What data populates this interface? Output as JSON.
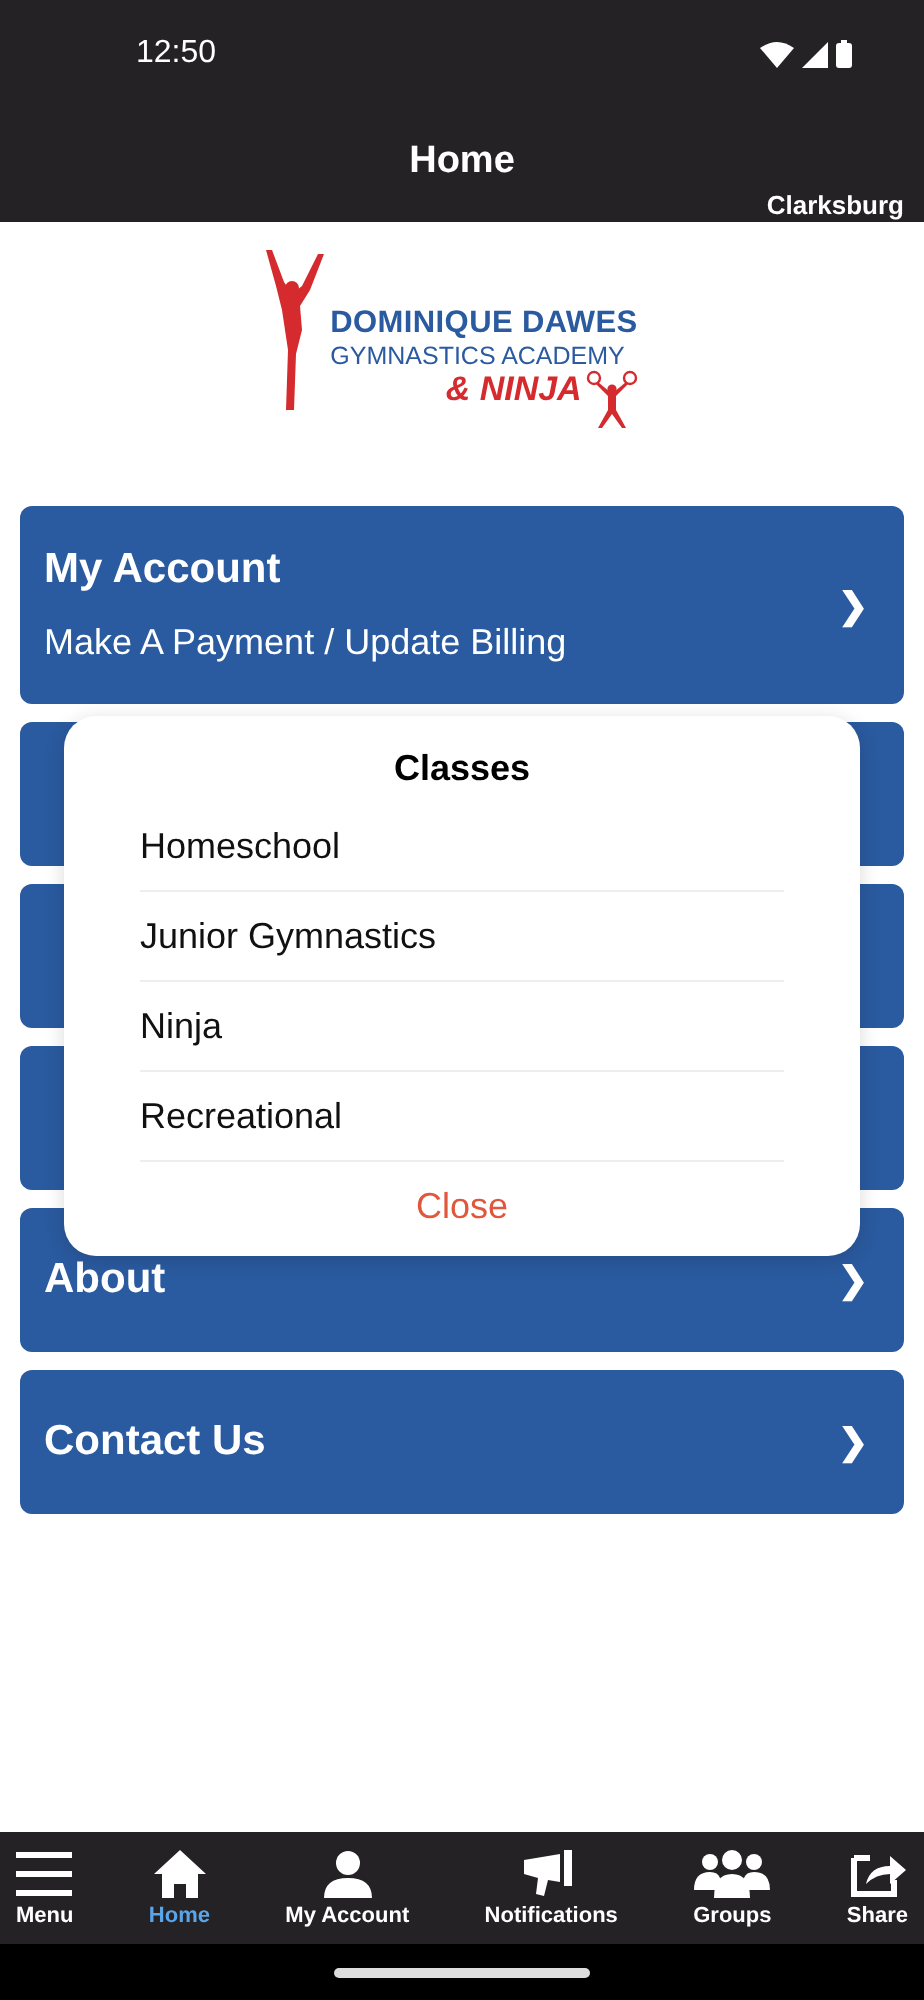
{
  "status_bar": {
    "time": "12:50"
  },
  "header": {
    "title": "Home",
    "location": "Clarksburg"
  },
  "logo": {
    "line_1": "DOMINIQUE DAWES",
    "line_2": "GYMNASTICS ACADEMY",
    "line_3": "& NINJA"
  },
  "menu_cards": [
    {
      "kind": "link",
      "title": "My Account",
      "subtitle": "Make A Payment / Update Billing",
      "chevron": "❯"
    },
    {
      "kind": "covered"
    },
    {
      "kind": "covered"
    },
    {
      "kind": "covered"
    },
    {
      "kind": "link",
      "title": "About",
      "chevron": "❯"
    },
    {
      "kind": "link",
      "title": "Contact Us",
      "chevron": "❯"
    }
  ],
  "dialog": {
    "title": "Classes",
    "options": [
      "Homeschool",
      "Junior Gymnastics",
      "Ninja",
      "Recreational"
    ],
    "close": "Close"
  },
  "tab_bar": [
    {
      "label": "Menu",
      "selected": false
    },
    {
      "label": "Home",
      "selected": true
    },
    {
      "label": "My Account",
      "selected": false
    },
    {
      "label": "Notifications",
      "selected": false
    },
    {
      "label": "Groups",
      "selected": false
    },
    {
      "label": "Share",
      "selected": false
    }
  ]
}
